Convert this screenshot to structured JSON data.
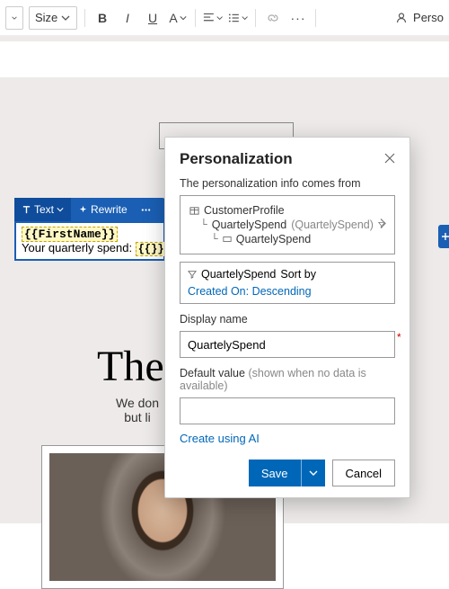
{
  "toolbar": {
    "font_dropdown": "",
    "size_label": "Size",
    "bold": "B",
    "italic": "I",
    "underline": "U",
    "fontcolor": "A",
    "personalize_short": "Perso"
  },
  "edit_inline": {
    "text_btn": "Text",
    "rewrite_btn": "Rewrite",
    "first_name_token": "{{FirstName}}",
    "spend_line_prefix": "Your quarterly spend: ",
    "spend_token": "{{}}"
  },
  "doc": {
    "heading_fragment": "The",
    "sub_line1": "We don",
    "sub_line2": "but li"
  },
  "panel": {
    "title": "Personalization",
    "comes_from": "The personalization info comes from",
    "tree": {
      "root": "CustomerProfile",
      "level1_name": "QuartelySpend",
      "level1_paren": "(QuartelySpend)",
      "level2": "QuartelySpend"
    },
    "sort": {
      "field": "QuartelySpend",
      "label": "Sort by",
      "link": "Created On: Descending"
    },
    "display_name_label": "Display name",
    "display_name_value": "QuartelySpend",
    "default_value_label": "Default value",
    "default_value_hint": "(shown when no data is available)",
    "default_value_value": "",
    "create_ai": "Create using AI",
    "save": "Save",
    "cancel": "Cancel"
  }
}
